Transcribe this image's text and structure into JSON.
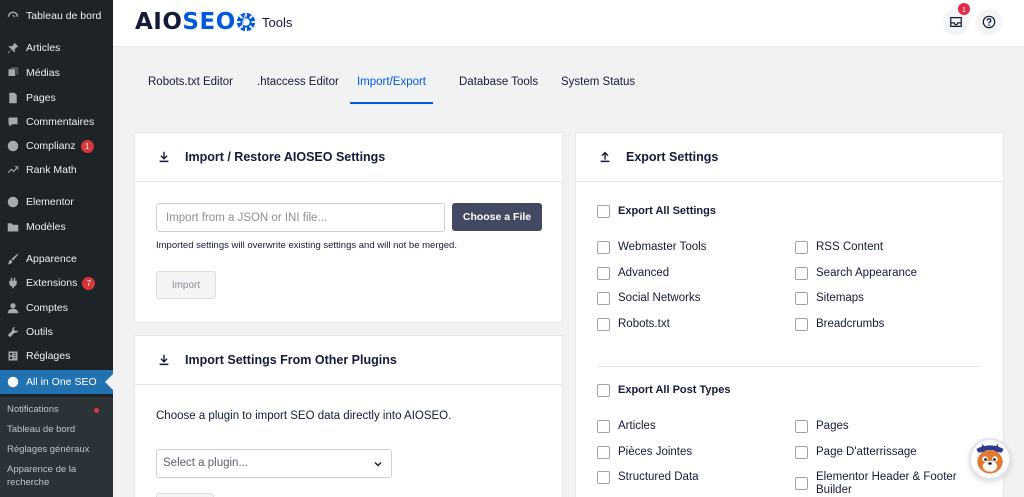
{
  "sidebar": {
    "items": [
      {
        "label": "Tableau de bord",
        "icon": "dashboard-icon"
      },
      {
        "label": "Articles",
        "icon": "pin-icon"
      },
      {
        "label": "Médias",
        "icon": "media-icon"
      },
      {
        "label": "Pages",
        "icon": "page-icon"
      },
      {
        "label": "Commentaires",
        "icon": "comment-icon"
      },
      {
        "label": "Complianz",
        "icon": "complianz-icon",
        "badge": "1"
      },
      {
        "label": "Rank Math",
        "icon": "rank-math-icon"
      },
      {
        "label": "Elementor",
        "icon": "elementor-icon"
      },
      {
        "label": "Modèles",
        "icon": "folder-icon"
      },
      {
        "label": "Apparence",
        "icon": "brush-icon"
      },
      {
        "label": "Extensions",
        "icon": "plugin-icon",
        "badge": "7"
      },
      {
        "label": "Comptes",
        "icon": "user-icon"
      },
      {
        "label": "Outils",
        "icon": "wrench-icon"
      },
      {
        "label": "Réglages",
        "icon": "settings-icon"
      },
      {
        "label": "All in One SEO",
        "icon": "aioseo-icon"
      }
    ],
    "submenu": [
      {
        "label": "Notifications"
      },
      {
        "label": "Tableau de bord"
      },
      {
        "label": "Réglages généraux"
      },
      {
        "label": "Apparence de la recherche"
      }
    ]
  },
  "header": {
    "logo_main": "AIO",
    "logo_accent": "SEO",
    "separator": "/",
    "title": "Tools",
    "notification_count": "1"
  },
  "tabs": [
    {
      "label": "Robots.txt Editor"
    },
    {
      "label": ".htaccess Editor"
    },
    {
      "label": "Import/Export",
      "active": true
    },
    {
      "label": "Database Tools"
    },
    {
      "label": "System Status"
    }
  ],
  "import_card": {
    "title": "Import / Restore AIOSEO Settings",
    "file_placeholder": "Import from a JSON or INI file...",
    "choose_label": "Choose a File",
    "warning": "Imported settings will overwrite existing settings and will not be merged.",
    "import_label": "Import"
  },
  "plugins_card": {
    "title": "Import Settings From Other Plugins",
    "description": "Choose a plugin to import SEO data directly into AIOSEO.",
    "select_placeholder": "Select a plugin..."
  },
  "export_card": {
    "title": "Export Settings",
    "export_all_settings": "Export All Settings",
    "settings_left": [
      "Webmaster Tools",
      "Advanced",
      "Social Networks",
      "Robots.txt"
    ],
    "settings_right": [
      "RSS Content",
      "Search Appearance",
      "Sitemaps",
      "Breadcrumbs"
    ],
    "export_all_post_types": "Export All Post Types",
    "post_types_left": [
      "Articles",
      "Pièces Jointes",
      "Structured Data"
    ],
    "post_types_right": [
      "Pages",
      "Page D'atterrissage",
      "Elementor Header & Footer Builder"
    ]
  },
  "colors": {
    "sidebar_bg": "#1d2327",
    "active_blue": "#2271b1",
    "brand_blue": "#005ae0",
    "dark_button": "#434960"
  }
}
